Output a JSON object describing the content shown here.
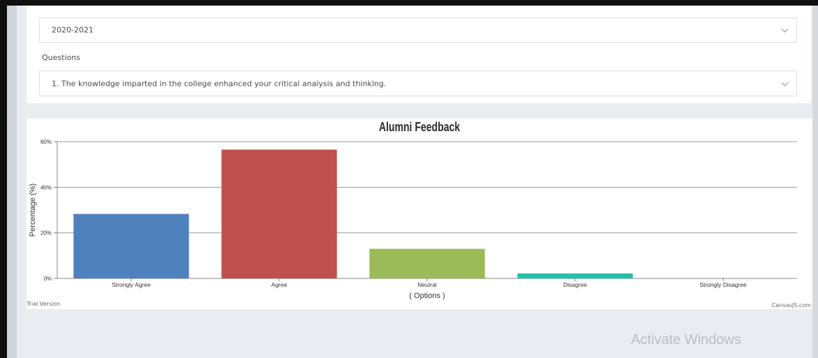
{
  "filters": {
    "year_value": "2020-2021",
    "questions_label": "Questions",
    "question_value": "1. The knowledge imparted in the college enhanced your critical analysis and thinking."
  },
  "watermarks": {
    "trial": "Trial Version",
    "canvasjs": "CanvasJS.com",
    "activate": "Activate Windows"
  },
  "chart_data": {
    "type": "bar",
    "title": "Alumni Feedback",
    "xlabel": "( Options )",
    "ylabel": "Percentage (%)",
    "categories": [
      "Strongly Agree",
      "Agree",
      "Neutral",
      "Disagree",
      "Strongly Disagree"
    ],
    "values": [
      28.3,
      56.5,
      13.0,
      2.2,
      0
    ],
    "colors": [
      "#4f81bc",
      "#c0504e",
      "#9bbb58",
      "#23bfaa",
      "#8064a1"
    ],
    "ylim": [
      0,
      60
    ],
    "yticks": [
      0,
      20,
      40,
      60
    ],
    "ytick_labels": [
      "0%",
      "20%",
      "40%",
      "60%"
    ],
    "grid": true
  }
}
